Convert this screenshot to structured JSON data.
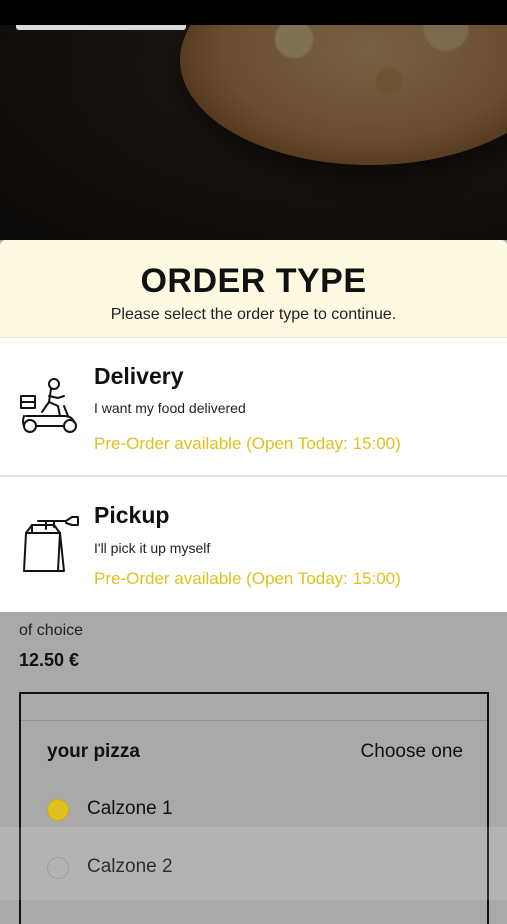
{
  "modal": {
    "title": "ORDER TYPE",
    "subtitle": "Please select the order type to continue.",
    "options": [
      {
        "icon": "delivery-scooter-icon",
        "title": "Delivery",
        "description": "I want my food delivered",
        "note": "Pre-Order available (Open Today: 15:00)"
      },
      {
        "icon": "pickup-bag-icon",
        "title": "Pickup",
        "description": "I'll pick it up myself",
        "note": "Pre-Order available (Open Today: 15:00)"
      }
    ]
  },
  "product": {
    "description_fragment": "of choice",
    "price": "12.50 €"
  },
  "choice_group": {
    "title": "your pizza",
    "hint": "Choose one",
    "options": [
      {
        "label": "Calzone 1",
        "selected": true
      },
      {
        "label": "Calzone 2",
        "selected": false
      }
    ]
  },
  "colors": {
    "accent": "#e0c21d",
    "header_bg": "#fdf9e3",
    "dim_bg": "#a9a9a9"
  }
}
